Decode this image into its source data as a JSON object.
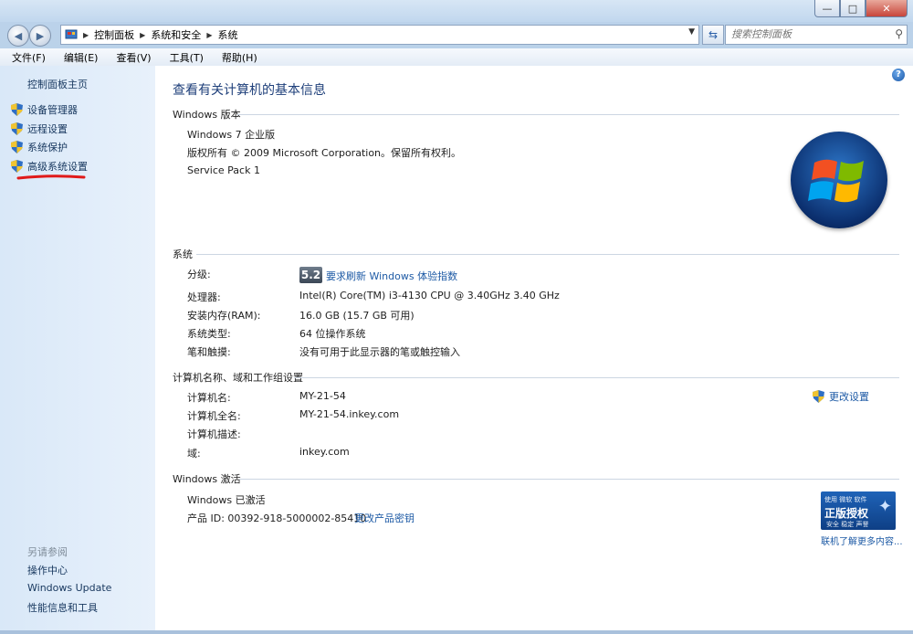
{
  "window": {
    "controls": {
      "minimize": "—",
      "maximize": "□",
      "close": "✕"
    }
  },
  "navigation": {
    "back_icon": "arrow-left",
    "forward_icon": "arrow-right",
    "breadcrumb": [
      "控制面板",
      "系统和安全",
      "系统"
    ],
    "search_placeholder": "搜索控制面板"
  },
  "menubar": [
    "文件(F)",
    "编辑(E)",
    "查看(V)",
    "工具(T)",
    "帮助(H)"
  ],
  "sidebar": {
    "home": "控制面板主页",
    "items": [
      "设备管理器",
      "远程设置",
      "系统保护",
      "高级系统设置"
    ],
    "see_also_title": "另请参阅",
    "see_also": [
      "操作中心",
      "Windows Update",
      "性能信息和工具"
    ]
  },
  "main": {
    "title": "查看有关计算机的基本信息",
    "edition": {
      "section": "Windows 版本",
      "name": "Windows 7 企业版",
      "copyright": "版权所有 © 2009 Microsoft Corporation。保留所有权利。",
      "service_pack": "Service Pack 1"
    },
    "system": {
      "section": "系统",
      "rating_label": "分级:",
      "rating_score": "5.2",
      "rating_link": "要求刷新 Windows 体验指数",
      "processor_label": "处理器:",
      "processor": "Intel(R) Core(TM) i3-4130 CPU @ 3.40GHz   3.40 GHz",
      "ram_label": "安装内存(RAM):",
      "ram": "16.0 GB (15.7 GB 可用)",
      "type_label": "系统类型:",
      "type": "64 位操作系统",
      "pen_label": "笔和触摸:",
      "pen": "没有可用于此显示器的笔或触控输入"
    },
    "computer": {
      "section": "计算机名称、域和工作组设置",
      "name_label": "计算机名:",
      "name": "MY-21-54",
      "fullname_label": "计算机全名:",
      "fullname": "MY-21-54.inkey.com",
      "desc_label": "计算机描述:",
      "desc": "",
      "domain_label": "域:",
      "domain": "inkey.com",
      "change_link": "更改设置"
    },
    "activation": {
      "section": "Windows 激活",
      "status": "Windows 已激活",
      "product_id": "产品 ID: 00392-918-5000002-85410",
      "change_key_link": "更改产品密钥",
      "badge_top": "使用 微软 软件",
      "badge_main": "正版授权",
      "badge_bottom": "安全 稳定 声誉",
      "learn_more": "联机了解更多内容..."
    }
  },
  "colors": {
    "link": "#1d5aa5",
    "title": "#1e3f7a",
    "sidebar_bg": "#dfeaf8",
    "highlight_mark": "#e01a1a"
  }
}
